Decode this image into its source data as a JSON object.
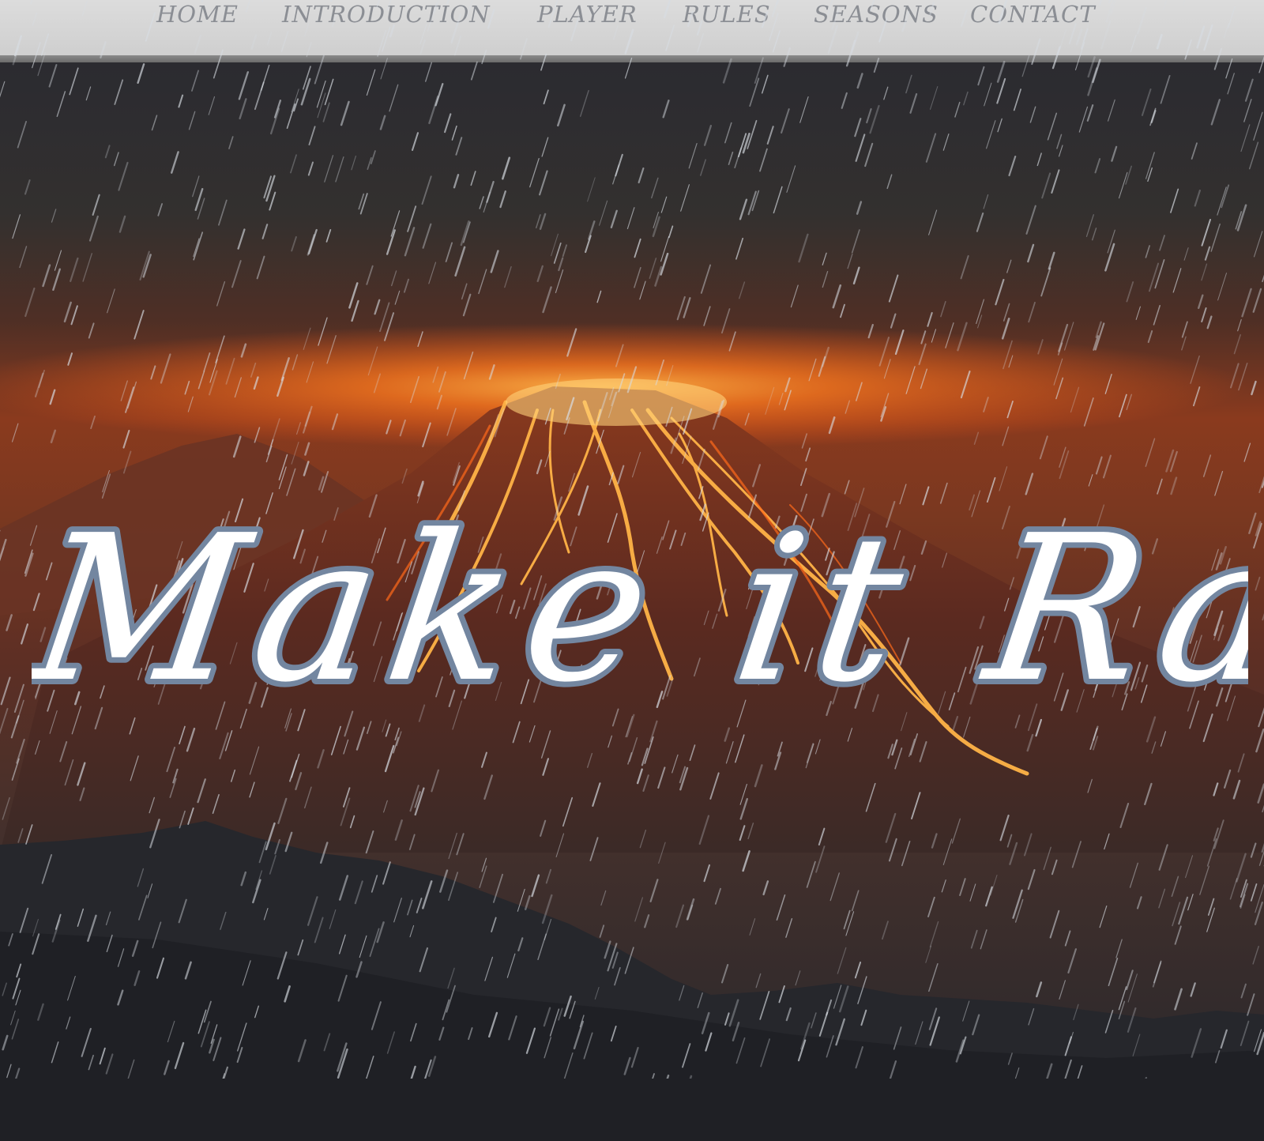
{
  "nav": {
    "items": [
      {
        "label": "HOME"
      },
      {
        "label": "INTRODUCTION"
      },
      {
        "label": "PLAYER"
      },
      {
        "label": "RULES"
      },
      {
        "label": "SEASONS"
      },
      {
        "label": "CONTACT"
      }
    ]
  },
  "hero": {
    "title": "Make it Rain",
    "background": "volcano-eruption-night-image",
    "overlay": "rain-streaks"
  },
  "colors": {
    "nav_bg": "#d3d3d3",
    "nav_text": "#8b8e94",
    "title_fill": "#ffffff",
    "title_outline": "#7386a0",
    "lava": "#ff6a1a"
  }
}
